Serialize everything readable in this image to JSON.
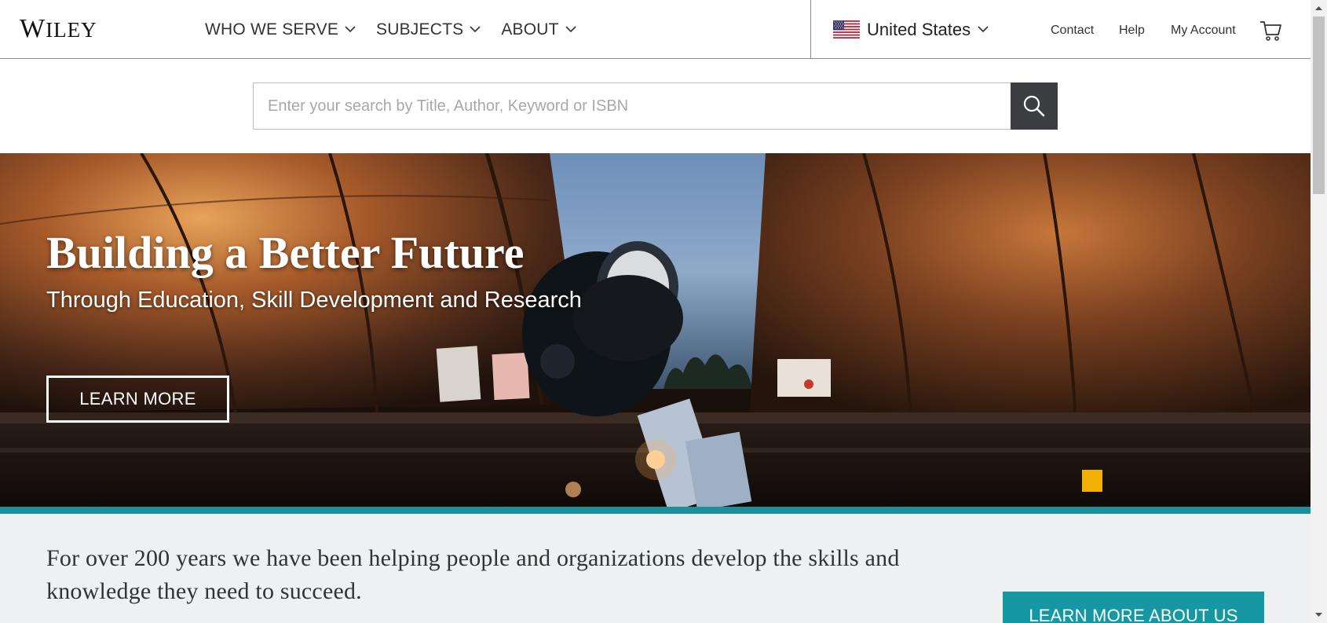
{
  "header": {
    "logo": {
      "prefix": "W",
      "rest": "ILEY"
    },
    "nav": [
      {
        "label": "WHO WE SERVE",
        "icon": "chevron-down-icon"
      },
      {
        "label": "SUBJECTS",
        "icon": "chevron-down-icon"
      },
      {
        "label": "ABOUT",
        "icon": "chevron-down-icon"
      }
    ],
    "country": {
      "label": "United States",
      "icon": "us-flag-icon"
    },
    "utility": {
      "contact": "Contact",
      "help": "Help",
      "account": "My Account",
      "cart_icon": "cart-icon"
    }
  },
  "search": {
    "placeholder": "Enter your search by Title, Author, Keyword or ISBN",
    "value": "",
    "button_icon": "search-icon"
  },
  "hero": {
    "title": "Building a Better Future",
    "subtitle": "Through Education, Skill Development and Research",
    "cta": "LEARN MORE",
    "accent_color": "#1b8f9b"
  },
  "about": {
    "text": "For over 200 years we have been helping people and organizations develop the skills and knowledge they need to succeed.",
    "cta": "LEARN MORE ABOUT US",
    "button_color": "#1598a4"
  }
}
